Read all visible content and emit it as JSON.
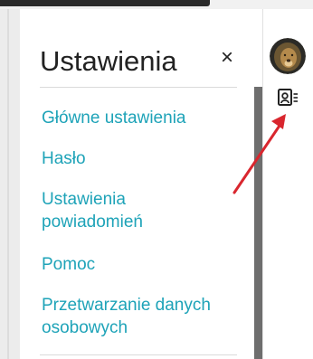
{
  "panel": {
    "title": "Ustawienia",
    "close_label": "×",
    "items": [
      {
        "label": "Główne ustawienia"
      },
      {
        "label": "Hasło"
      },
      {
        "label": "Ustawienia powiadomień"
      },
      {
        "label": "Pomoc"
      },
      {
        "label": "Przetwarzanie danych osobowych"
      }
    ]
  },
  "icons": {
    "close": "close-icon",
    "avatar": "lion-avatar",
    "consent": "contact-list-icon",
    "annotation": "red-arrow"
  },
  "colors": {
    "link": "#1ea3b8",
    "annotation_arrow": "#d9262e",
    "scrollbar": "#6e6e6e"
  }
}
